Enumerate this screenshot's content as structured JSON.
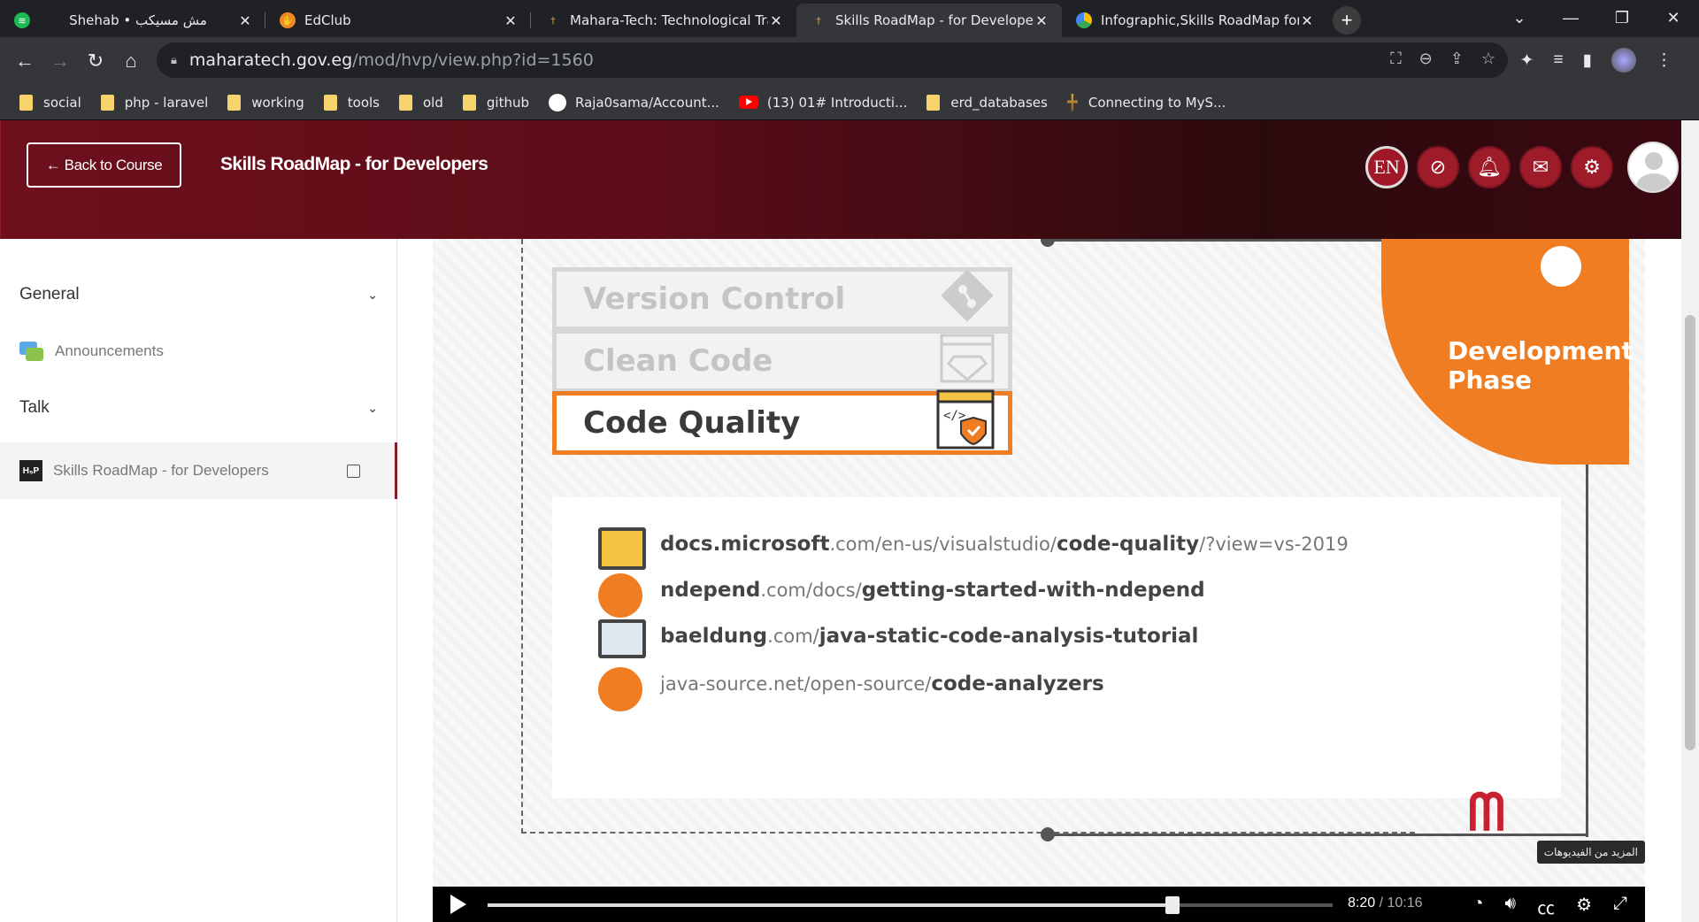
{
  "browser": {
    "tabs": [
      {
        "title": "Shehab • مش مسيكب",
        "favicon": "spotify-icon",
        "active": false
      },
      {
        "title": "EdClub",
        "favicon": "edclub-icon",
        "active": false
      },
      {
        "title": "Mahara-Tech: Technological Trac",
        "favicon": "maharatech-icon",
        "active": false
      },
      {
        "title": "Skills RoadMap - for Developers",
        "favicon": "maharatech-icon",
        "active": true
      },
      {
        "title": "Infographic,Skills RoadMap for d",
        "favicon": "google-drive-icon",
        "active": false
      }
    ],
    "new_tab": "+",
    "url_host": "maharatech.gov.eg",
    "url_path": "/mod/hvp/view.php?id=1560",
    "bookmarks": [
      {
        "label": "social",
        "icon": "folder-icon"
      },
      {
        "label": "php - laravel",
        "icon": "folder-icon"
      },
      {
        "label": "working",
        "icon": "folder-icon"
      },
      {
        "label": "tools",
        "icon": "folder-icon"
      },
      {
        "label": "old",
        "icon": "folder-icon"
      },
      {
        "label": "github",
        "icon": "folder-icon"
      },
      {
        "label": "Raja0sama/Account...",
        "icon": "github-icon"
      },
      {
        "label": "(13) 01# Introducti...",
        "icon": "youtube-icon"
      },
      {
        "label": "erd_databases",
        "icon": "folder-icon"
      },
      {
        "label": "Connecting to MyS...",
        "icon": "maharatech-icon"
      }
    ]
  },
  "header": {
    "back_label": "← Back to Course",
    "course_title": "Skills RoadMap - for Developers",
    "lang_label": "EN"
  },
  "sidebar": {
    "sections": [
      {
        "label": "General"
      },
      {
        "label": "Talk"
      }
    ],
    "announcements": "Announcements",
    "active_item": "Skills RoadMap - for Developers",
    "active_icon_text": "H₅P"
  },
  "slide": {
    "pills": [
      {
        "label": "Version Control",
        "state": "inactive"
      },
      {
        "label": "Clean Code",
        "state": "inactive"
      },
      {
        "label": "Code Quality",
        "state": "active"
      }
    ],
    "phase_line1": "Development",
    "phase_line2": "Phase",
    "links": [
      {
        "bold1": "docs.microsoft",
        "rest1": ".com/en-us/visualstudio/",
        "bold2": "code-quality",
        "rest2": "/?view=vs-2019"
      },
      {
        "bold1": "ndepend",
        "rest1": ".com/docs/",
        "bold2": "getting-started-with-ndepend",
        "rest2": ""
      },
      {
        "bold1": "baeldung",
        "rest1": ".com/",
        "bold2": "java-static-code-analysis-tutorial",
        "rest2": ""
      },
      {
        "bold1": "",
        "rest1": "java-source.net/open-source/",
        "bold2": "code-analyzers",
        "rest2": ""
      }
    ],
    "tooltip": "المزيد من الفيديوهات"
  },
  "player": {
    "current_time": "8:20",
    "duration": "/ 10:16",
    "progress": 0.81
  },
  "colors": {
    "accent_orange": "#f07d22",
    "header_red": "#6e0f1c",
    "brand_red": "#9e1b2a"
  }
}
